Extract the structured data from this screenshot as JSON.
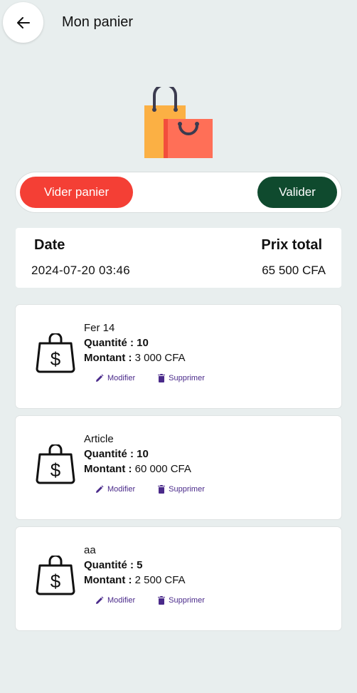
{
  "header": {
    "title": "Mon panier",
    "back_icon": "arrow-left-icon"
  },
  "illustration": {
    "icon": "shopping-bags-icon"
  },
  "actions": {
    "empty_label": "Vider panier",
    "validate_label": "Valider",
    "colors": {
      "empty": "#f43f35",
      "validate": "#0f4a2e"
    }
  },
  "summary": {
    "date_label": "Date",
    "total_label": "Prix total",
    "date_value": "2024-07-20 03:46",
    "total_value": "65 500 CFA"
  },
  "items": [
    {
      "name": "Fer 14",
      "qty_label": "Quantité : ",
      "qty": "10",
      "amount_label": "Montant : ",
      "amount": "3 000 CFA",
      "edit_label": "Modifier",
      "delete_label": "Supprimer"
    },
    {
      "name": "Article",
      "qty_label": "Quantité : ",
      "qty": "10",
      "amount_label": "Montant : ",
      "amount": "60 000 CFA",
      "edit_label": "Modifier",
      "delete_label": "Supprimer"
    },
    {
      "name": "aa",
      "qty_label": "Quantité : ",
      "qty": "5",
      "amount_label": "Montant : ",
      "amount": "2 500 CFA",
      "edit_label": "Modifier",
      "delete_label": "Supprimer"
    }
  ],
  "icons": {
    "item": "money-bag-icon",
    "edit": "pencil-icon",
    "delete": "trash-icon"
  }
}
